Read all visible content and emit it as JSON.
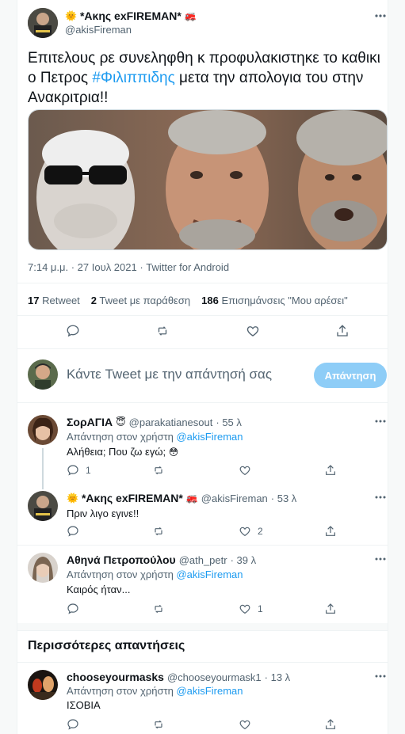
{
  "tweet": {
    "author_name": "*Ακης exFIREMAN*",
    "author_handle": "@akisFireman",
    "text_before": "Επιτελους ρε συνεληφθη κ προφυλακιστηκε το καθικι ο Πετρος ",
    "hashtag": "#Φιλιππιδης",
    "text_after": " μετα την απολογια του στην Ανακριτρια!!",
    "meta": "7:14 μ.μ. · 27 Ιουλ 2021 · Twitter for Android",
    "stats": {
      "retweets_count": "17",
      "retweets_label": "Retweet",
      "quotes_count": "2",
      "quotes_label": "Tweet με παράθεση",
      "likes_count": "186",
      "likes_label": "Επισημάνσεις \"Μου αρέσει\""
    }
  },
  "composer": {
    "prompt": "Κάντε Tweet με την απάντησή σας",
    "reply_button": "Απάντηση"
  },
  "replies": [
    {
      "name": "ΣορΑΓΙΑ",
      "badge_emoji": "😇",
      "handle": "@parakatianesout",
      "time": "· 55 λ",
      "reply_prefix": "Απάντηση στον χρήστη",
      "reply_to": "@akisFireman",
      "text": "Αλήθεια; Που ζω εγώ;",
      "text_emoji": "😳",
      "reply_count": "1",
      "like_count": ""
    },
    {
      "name": "*Ακης exFIREMAN*",
      "handle": "@akisFireman",
      "time": "· 53 λ",
      "text": "Πριν λιγο εγινε!!",
      "reply_count": "",
      "like_count": "2"
    },
    {
      "name": "Αθηνά Πετροπούλου",
      "handle": "@ath_petr",
      "time": "· 39 λ",
      "reply_prefix": "Απάντηση στον χρήστη",
      "reply_to": "@akisFireman",
      "text": "Καιρός ήταν...",
      "reply_count": "",
      "like_count": "1"
    }
  ],
  "more_replies_heading": "Περισσότερες απαντήσεις",
  "more_reply": {
    "name": "chooseyourmasks",
    "handle": "@chooseyourmask1",
    "time": "· 13 λ",
    "reply_prefix": "Απάντηση στον χρήστη",
    "reply_to": "@akisFireman",
    "text": "ΙΣΟΒΙΑ"
  },
  "colors": {
    "accent": "#1d9bf0",
    "reply_button": "#8ecdf7",
    "muted": "#536471"
  }
}
